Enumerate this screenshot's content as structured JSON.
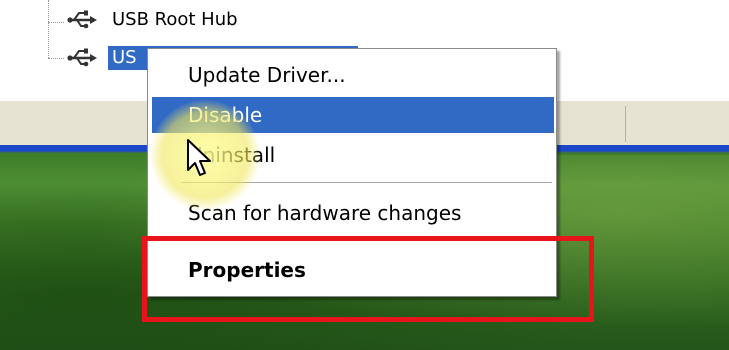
{
  "tree": {
    "items": [
      {
        "label": "USB Root Hub",
        "icon": "usb-icon",
        "selected": false
      },
      {
        "label": "US",
        "icon": "usb-icon",
        "selected": true
      }
    ]
  },
  "context_menu": {
    "items": [
      {
        "label": "Update Driver...",
        "highlighted": false,
        "bold": false
      },
      {
        "label": "Disable",
        "highlighted": true,
        "bold": false
      },
      {
        "label": "Uninstall",
        "highlighted": false,
        "bold": false
      },
      {
        "label": "Scan for hardware changes",
        "highlighted": false,
        "bold": false
      },
      {
        "label": "Properties",
        "highlighted": false,
        "bold": true
      }
    ]
  },
  "colors": {
    "selection": "#316ac5",
    "annotation": "#e8141b",
    "cursor_halo": "#f0e65a"
  }
}
